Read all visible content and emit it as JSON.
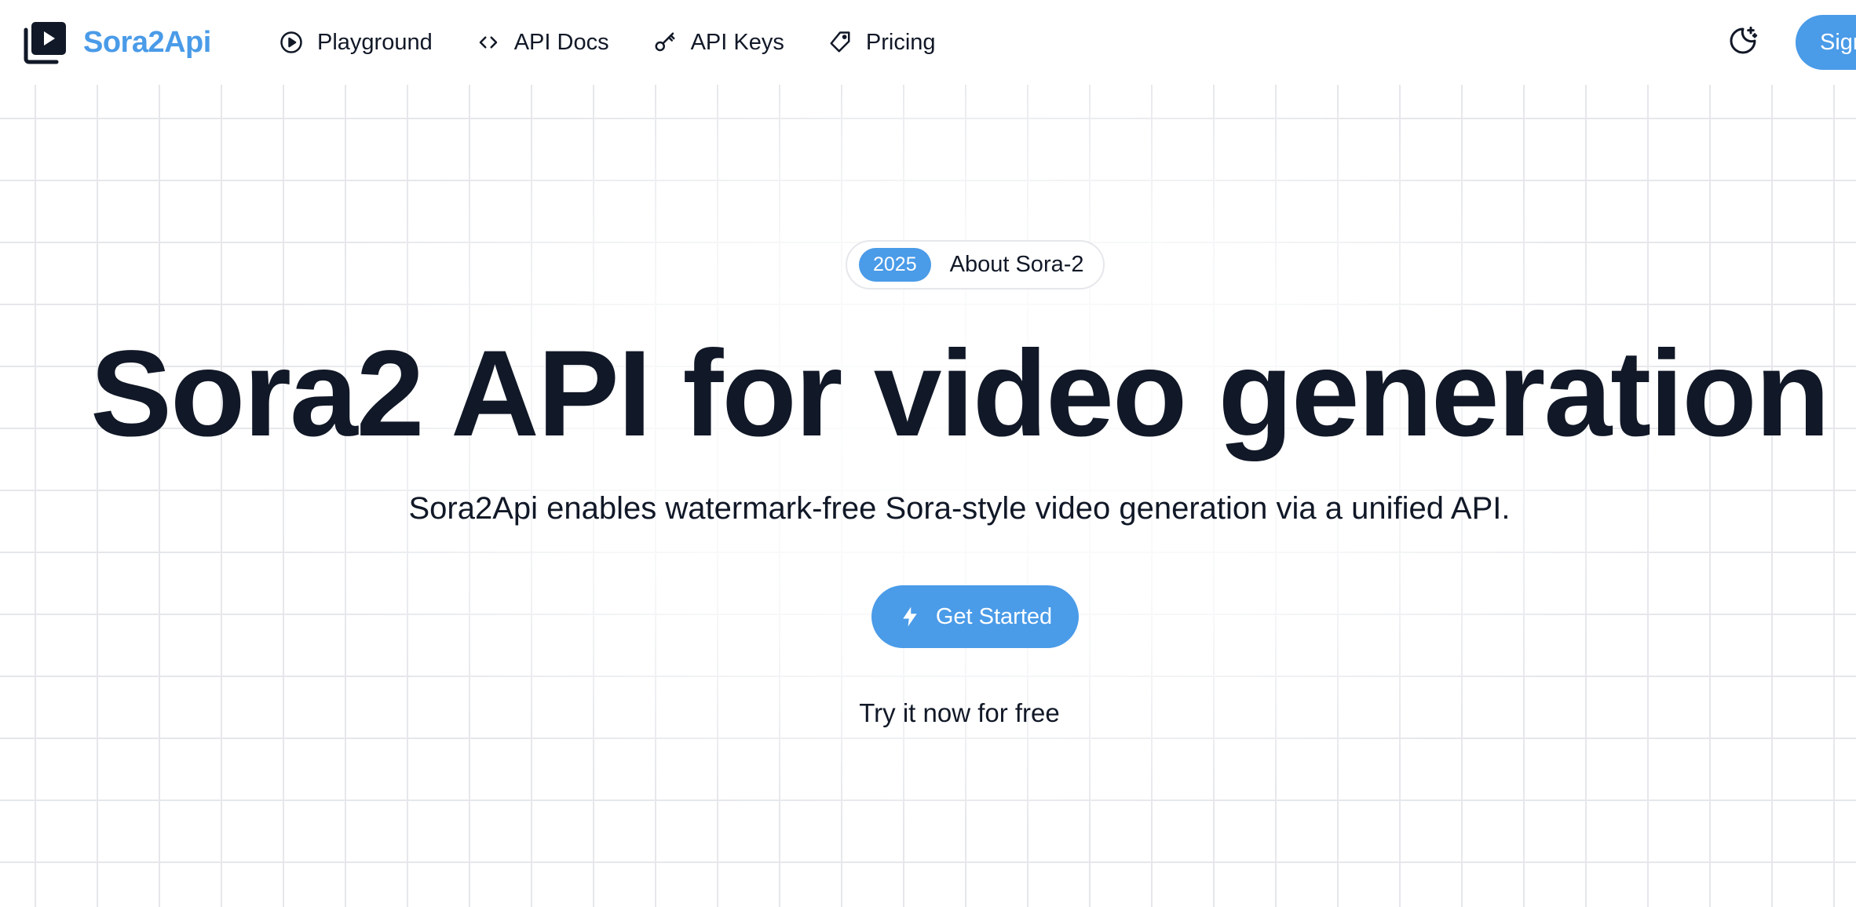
{
  "brand": {
    "name": "Sora2Api",
    "color": "#4a9be8",
    "icon": "video-library-icon"
  },
  "nav": {
    "items": [
      {
        "label": "Playground",
        "icon": "play-circle-icon"
      },
      {
        "label": "API Docs",
        "icon": "code-icon"
      },
      {
        "label": "API Keys",
        "icon": "key-icon"
      },
      {
        "label": "Pricing",
        "icon": "tag-icon"
      }
    ]
  },
  "header": {
    "theme_toggle_icon": "moon-stars-icon",
    "signin_label": "Sign in"
  },
  "hero": {
    "badge_year": "2025",
    "badge_label": "About Sora-2",
    "title": "Sora2 API for video generation",
    "subtitle": "Sora2Api enables watermark-free Sora-style video generation via a unified API.",
    "cta_label": "Get Started",
    "cta_icon": "lightning-icon",
    "free_text": "Try it now for free"
  },
  "colors": {
    "accent": "#4a9be8",
    "text": "#111827",
    "grid": "#e5e7eb"
  }
}
